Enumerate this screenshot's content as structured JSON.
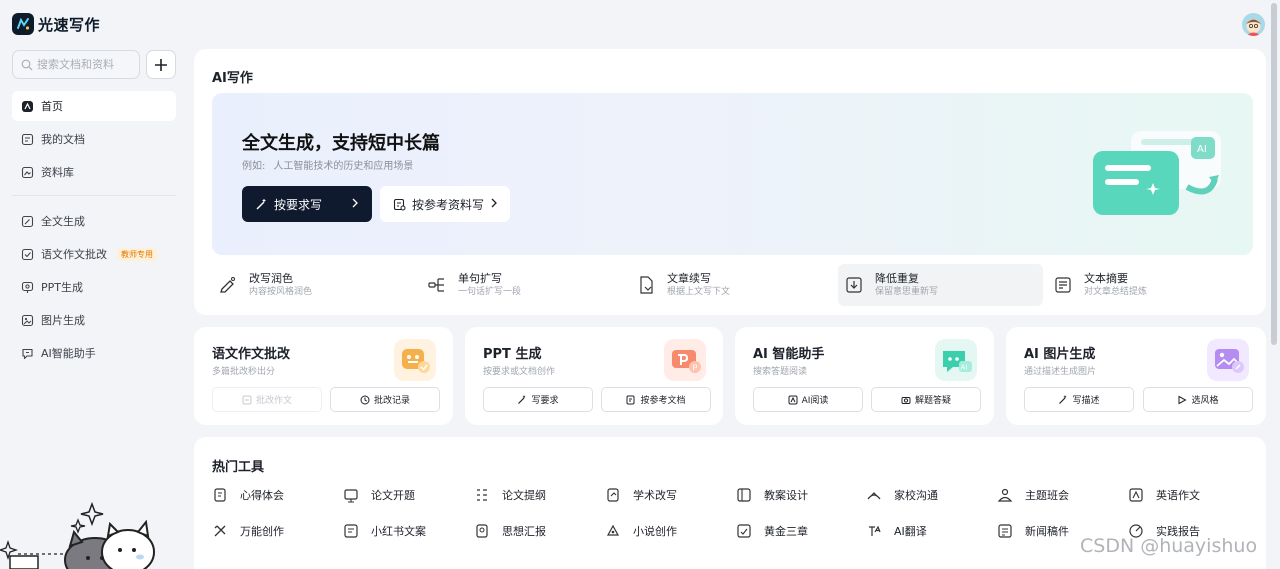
{
  "app": {
    "name": "光速写作"
  },
  "sidebar": {
    "search_placeholder": "搜索文档和资料",
    "items": [
      {
        "label": "首页",
        "icon": "home-icon"
      },
      {
        "label": "我的文档",
        "icon": "document-icon"
      },
      {
        "label": "资料库",
        "icon": "library-icon"
      },
      {
        "label": "全文生成",
        "icon": "pen-icon"
      },
      {
        "label": "语文作文批改",
        "icon": "check-icon",
        "badge": "教师专用"
      },
      {
        "label": "PPT生成",
        "icon": "presentation-icon"
      },
      {
        "label": "图片生成",
        "icon": "image-icon"
      },
      {
        "label": "AI智能助手",
        "icon": "chat-icon"
      }
    ]
  },
  "ai_writing": {
    "title": "AI写作",
    "hero": {
      "title": "全文生成，支持短中长篇",
      "example_prefix": "例如:",
      "example": "人工智能技术的历史和应用场景",
      "primary_button": "按要求写",
      "secondary_button": "按参考资料写"
    },
    "tools": [
      {
        "title": "改写润色",
        "desc": "内容按风格润色"
      },
      {
        "title": "单句扩写",
        "desc": "一句话扩写一段"
      },
      {
        "title": "文章续写",
        "desc": "根据上文写下文"
      },
      {
        "title": "降低重复",
        "desc": "保留意思重新写"
      },
      {
        "title": "文本摘要",
        "desc": "对文章总结提炼"
      }
    ]
  },
  "feature_cards": [
    {
      "title": "语文作文批改",
      "desc": "多篇批改秒出分",
      "buttons": [
        "批改作文",
        "批改记录"
      ]
    },
    {
      "title": "PPT 生成",
      "desc": "按要求或文档创作",
      "buttons": [
        "写要求",
        "按参考文档"
      ]
    },
    {
      "title": "AI 智能助手",
      "desc": "搜索答题阅读",
      "buttons": [
        "AI阅读",
        "解题答疑"
      ]
    },
    {
      "title": "AI 图片生成",
      "desc": "通过描述生成图片",
      "buttons": [
        "写描述",
        "选风格"
      ]
    }
  ],
  "hot_tools": {
    "title": "热门工具",
    "row1": [
      "心得体会",
      "论文开题",
      "论文提纲",
      "学术改写",
      "教案设计",
      "家校沟通",
      "主题班会",
      "英语作文"
    ],
    "row2": [
      "万能创作",
      "小红书文案",
      "思想汇报",
      "小说创作",
      "黄金三章",
      "AI翻译",
      "新闻稿件",
      "实践报告"
    ]
  },
  "watermark": "CSDN @huayishuo",
  "colors": {
    "primary": "#101a2e",
    "accent": "#2ec4a6",
    "badge": "#e07b00"
  }
}
